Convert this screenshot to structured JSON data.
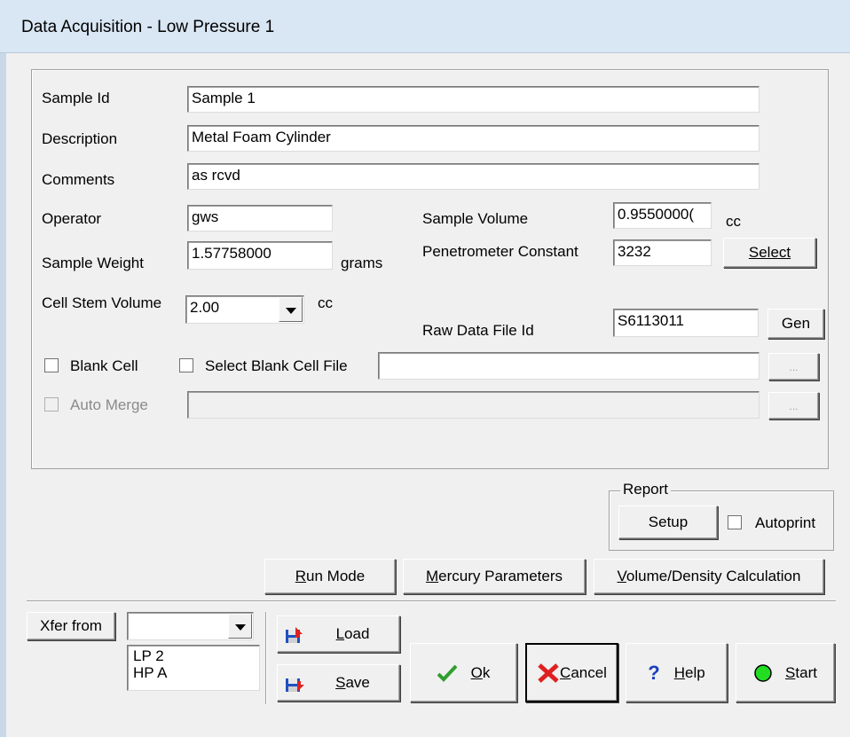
{
  "window": {
    "title": "Data Acquisition - Low Pressure 1"
  },
  "form": {
    "sample_id": {
      "label": "Sample Id",
      "value": "Sample 1"
    },
    "description": {
      "label": "Description",
      "value": "Metal Foam Cylinder"
    },
    "comments": {
      "label": "Comments",
      "value": "as rcvd"
    },
    "operator": {
      "label": "Operator",
      "value": "gws"
    },
    "sample_weight": {
      "label": "Sample Weight",
      "value": "1.57758000",
      "unit": "grams"
    },
    "cell_stem_volume": {
      "label": "Cell Stem Volume",
      "value": "2.00",
      "unit": "cc"
    },
    "sample_volume": {
      "label": "Sample Volume",
      "value": "0.9550000(",
      "unit": "cc"
    },
    "penetrometer_constant": {
      "label": "Penetrometer Constant",
      "value": "3232",
      "button": "Select"
    },
    "raw_data_file_id": {
      "label": "Raw Data File Id",
      "value": "S6113011",
      "button": "Gen"
    },
    "blank_cell": {
      "label": "Blank Cell",
      "checked": false
    },
    "select_blank_cell_file": {
      "label": "Select Blank Cell File",
      "checked": false,
      "value": "",
      "browse": "..."
    },
    "auto_merge": {
      "label": "Auto Merge",
      "checked": false,
      "value": "",
      "browse": "...",
      "disabled": true
    }
  },
  "report": {
    "group_label": "Report",
    "setup_label": "Setup",
    "autoprint_label": "Autoprint",
    "autoprint_checked": false
  },
  "actions": {
    "run_mode": "Run Mode",
    "mercury_parameters": "Mercury Parameters",
    "volume_density": "Volume/Density Calculation"
  },
  "xfer": {
    "button": "Xfer from",
    "selected": "",
    "options": [
      "LP 2",
      "HP A"
    ]
  },
  "bottom": {
    "load": "Load",
    "save": "Save",
    "ok": "Ok",
    "cancel": "Cancel",
    "help": "Help",
    "start": "Start"
  },
  "colors": {
    "title_bg": "#d9e6f3",
    "ok_check": "#2e9e2e",
    "cancel_x": "#e02020",
    "help_q": "#1a3fc0",
    "start_circle": "#22dd22"
  }
}
